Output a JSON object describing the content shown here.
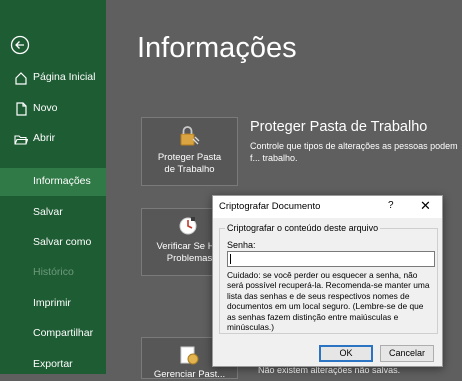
{
  "sidebar": {
    "back_label": "Voltar",
    "items": [
      {
        "label": "Página Inicial"
      },
      {
        "label": "Novo"
      },
      {
        "label": "Abrir"
      },
      {
        "label": "Informações"
      },
      {
        "label": "Salvar"
      },
      {
        "label": "Salvar como"
      },
      {
        "label": "Histórico"
      },
      {
        "label": "Imprimir"
      },
      {
        "label": "Compartilhar"
      },
      {
        "label": "Exportar"
      }
    ],
    "active_item": "Informações"
  },
  "main": {
    "title": "Informações",
    "protect": {
      "tile_line1": "Proteger Pasta",
      "tile_line2": "de Trabalho",
      "heading": "Proteger Pasta de Trabalho",
      "description": "Controle que tipos de alterações as pessoas podem f... trabalho."
    },
    "inspect": {
      "tile_line1": "Verificar Se H...",
      "tile_line2": "Problemas"
    },
    "manage": {
      "tile_line1": "Gerenciar Past..."
    },
    "peek_text": "Não existem alterações não salvas."
  },
  "dialog": {
    "title": "Criptografar Documento",
    "help": "?",
    "close": "✕",
    "group_title": "Criptografar o conteúdo deste arquivo",
    "password_label": "Senha:",
    "password_value": "",
    "warning": "Cuidado: se você perder ou esquecer a senha, não será possível recuperá-la. Recomenda-se manter uma lista das senhas e de seus respectivos nomes de documentos em um local seguro. (Lembre-se de que as senhas fazem distinção entre maiúsculas e minúsculas.)",
    "ok_label": "OK",
    "cancel_label": "Cancelar"
  },
  "colors": {
    "sidebar": "#1e5c34",
    "sidebar_active": "#2f7a46",
    "main_bg": "#5f5f5f"
  }
}
